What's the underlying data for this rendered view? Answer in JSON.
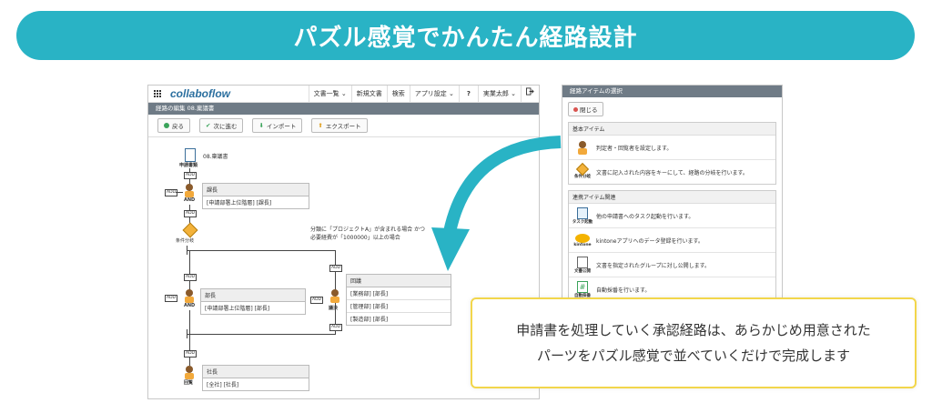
{
  "banner": {
    "title": "パズル感覚でかんたん経路設計"
  },
  "app": {
    "logo": "collaboflow",
    "menu": [
      "文書一覧 ⌄",
      "新規文書",
      "検索",
      "アプリ設定 ⌄",
      "?",
      "実業太郎 ⌄"
    ],
    "window_title": "経路の編集 08.稟議書",
    "toolbar": {
      "back": "戻る",
      "next": "次に進む",
      "import": "インポート",
      "export": "エクスポート"
    }
  },
  "route": {
    "applicant_label": "申請書類",
    "doc_name": "08.稟議書",
    "and_label": "AND",
    "step1": {
      "header": "課長",
      "row": "[申請部署上位階層] [課長]"
    },
    "condition_label": "条件分岐",
    "condition_text_1": "分類に「プロジェクトA」が含まれる場合 かつ",
    "condition_text_2": "必要経費が「1000000」以上の場合",
    "step2": {
      "header": "部長",
      "row": "[申請部署上位階層] [部長]"
    },
    "step3": {
      "header": "回議",
      "rows": [
        "[業務部] [部長]",
        "[管理部] [部長]",
        "[製造部] [部長]"
      ],
      "label": "議決"
    },
    "step4": {
      "header": "社長",
      "rows": [
        "[全社] [社長]"
      ],
      "label": "回覧"
    },
    "chip_label": "ADD"
  },
  "panel": {
    "title": "経路アイテムの選択",
    "close": "閉じる",
    "basic": {
      "header": "基本アイテム",
      "items": [
        {
          "icon": "",
          "text": "判定者・回覧者を設定します。"
        },
        {
          "icon": "条件分岐",
          "text": "文書に記入された内容をキーにして、経路の分岐を行います。"
        }
      ]
    },
    "linked": {
      "header": "連携アイテム関連",
      "items": [
        {
          "icon": "タスク起動",
          "text": "他の申請書へのタスク起動を行います。"
        },
        {
          "icon": "kintone",
          "text": "kintoneアプリへのデータ登録を行います。"
        },
        {
          "icon": "文書公開",
          "text": "文書を指定されたグループに対し公開します。"
        },
        {
          "icon": "自動採番",
          "text": "自動採番を行います。"
        }
      ]
    }
  },
  "callout": {
    "line1": "申請書を処理していく承認経路は、あらかじめ用意された",
    "line2": "パーツをパズル感覚で並べていくだけで完成します"
  },
  "colors": {
    "banner": "#29b3c5",
    "arrow": "#29b3c5",
    "callout_border": "#f2d64b"
  }
}
